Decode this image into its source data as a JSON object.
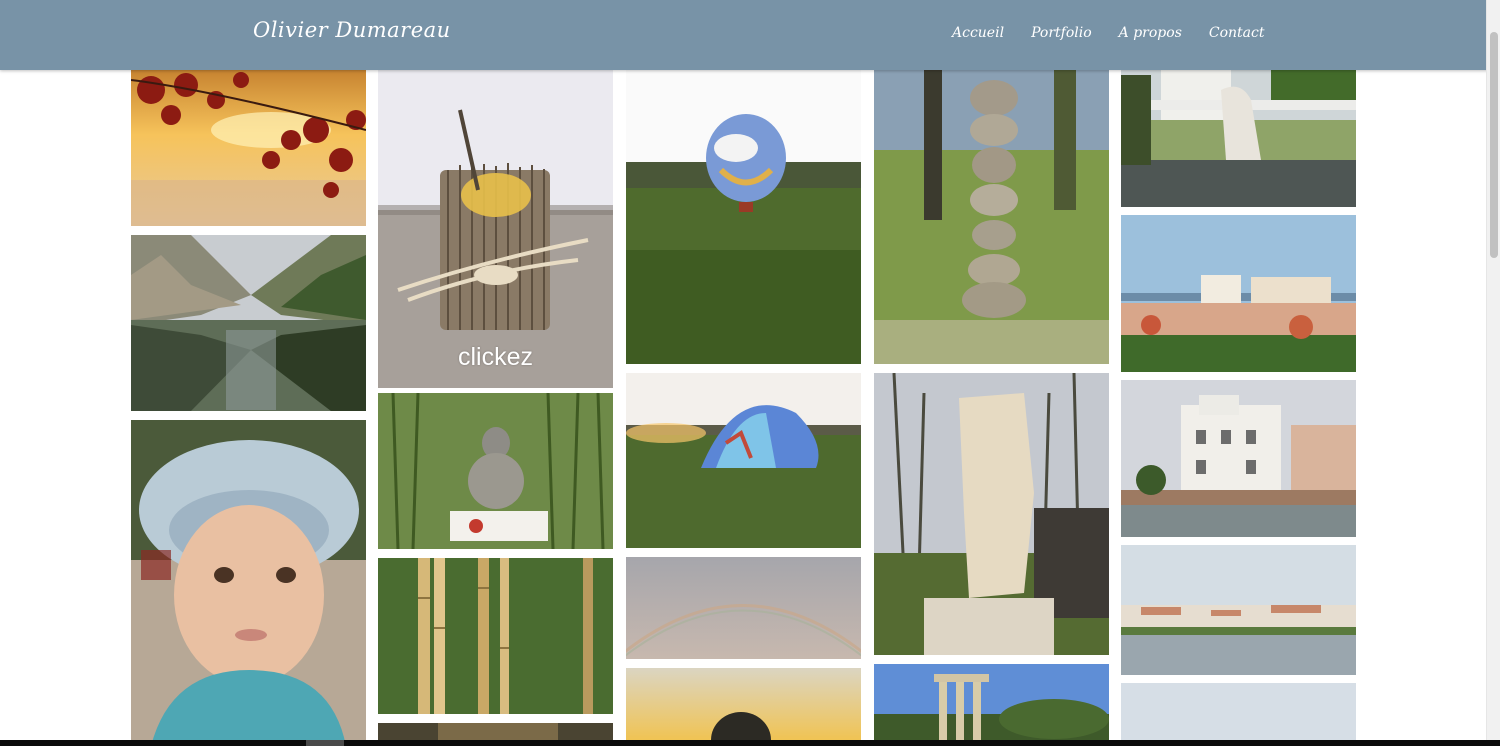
{
  "header": {
    "brand": "Olivier Dumareau",
    "nav": [
      {
        "label": "Accueil"
      },
      {
        "label": "Portfolio"
      },
      {
        "label": "A propos"
      },
      {
        "label": "Contact"
      }
    ]
  },
  "gallery": {
    "overlay_caption": "clickez",
    "photos": [
      {
        "name": "photo-autumn-leaves"
      },
      {
        "name": "photo-gorge-river"
      },
      {
        "name": "photo-child-hat"
      },
      {
        "name": "photo-wood-candle"
      },
      {
        "name": "photo-buddha-statue"
      },
      {
        "name": "photo-bamboo"
      },
      {
        "name": "photo-partial-2"
      },
      {
        "name": "photo-balloon-field"
      },
      {
        "name": "photo-balloon-inflating"
      },
      {
        "name": "photo-rainbow-sky"
      },
      {
        "name": "photo-sunset-balloon"
      },
      {
        "name": "photo-stacked-stones"
      },
      {
        "name": "photo-stone-sculpture"
      },
      {
        "name": "photo-temple-columns"
      },
      {
        "name": "photo-villa-statue"
      },
      {
        "name": "photo-seaside-buildings"
      },
      {
        "name": "photo-white-villa"
      },
      {
        "name": "photo-harbor-view"
      },
      {
        "name": "photo-partial-5"
      }
    ]
  }
}
